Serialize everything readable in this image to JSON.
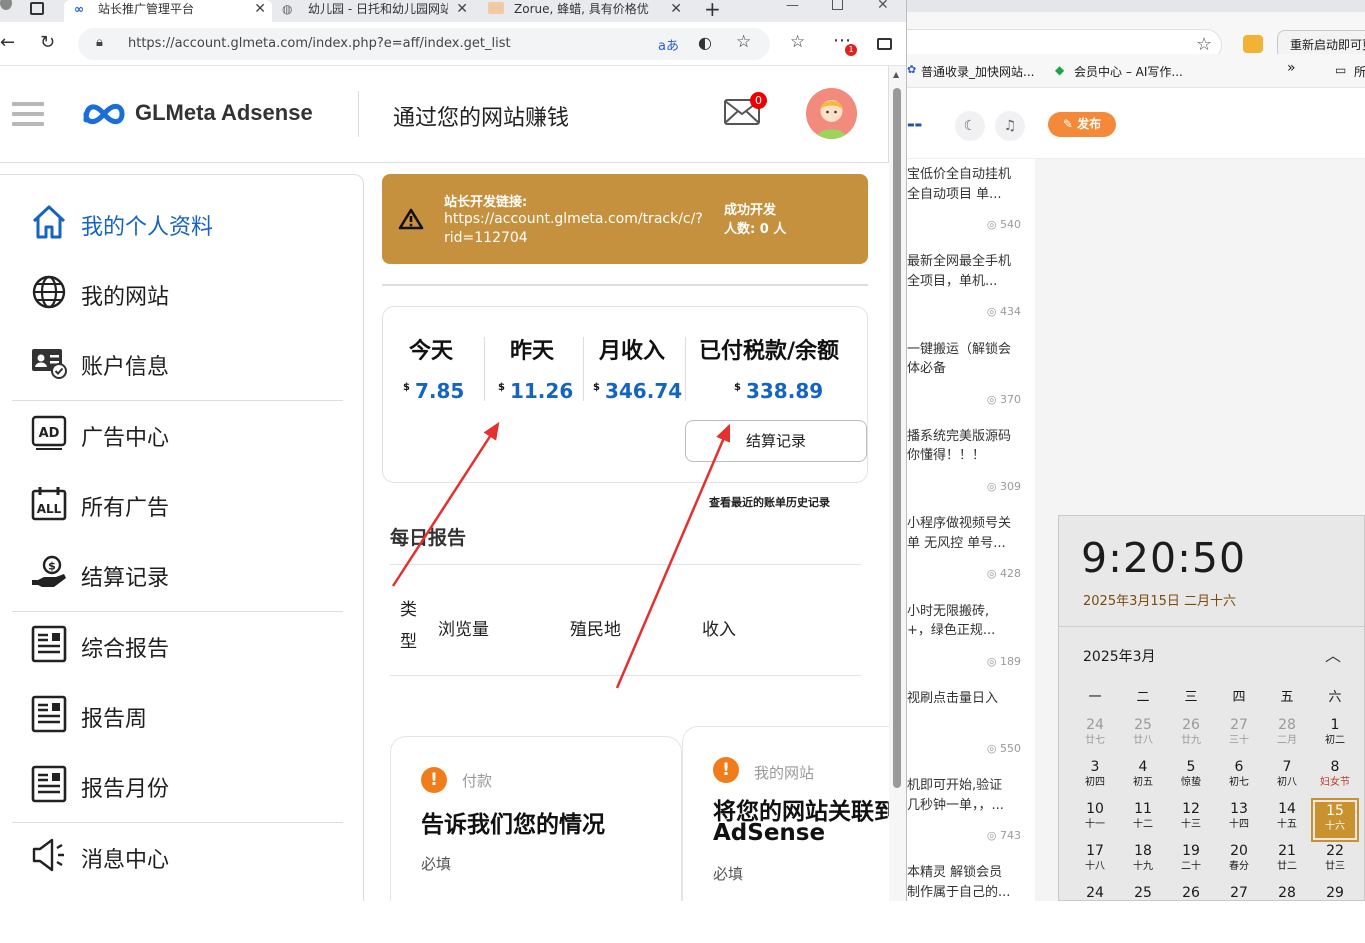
{
  "browser": {
    "tabs": [
      {
        "title": "站长推广管理平台",
        "active": true
      },
      {
        "title": "幼儿园 - 日托和幼儿园网站",
        "active": false
      },
      {
        "title": "Zorue, 蜂蜡, 具有价格优",
        "active": false
      }
    ],
    "new_tab": "+",
    "url": "https://account.glmeta.com/index.php?e=aff/index.get_list",
    "badge_count": "1"
  },
  "header": {
    "logo": "GLMeta Adsense",
    "tagline": "通过您的网站赚钱",
    "mail_count": "0"
  },
  "sidebar": {
    "items": [
      {
        "label": "我的个人资料",
        "icon": "home-icon",
        "active": true
      },
      {
        "label": "我的网站",
        "icon": "globe-icon"
      },
      {
        "label": "账户信息",
        "icon": "account-card-icon"
      },
      {
        "label": "广告中心",
        "icon": "ad-icon"
      },
      {
        "label": "所有广告",
        "icon": "all-ads-calendar-icon"
      },
      {
        "label": "结算记录",
        "icon": "payment-hand-icon"
      },
      {
        "label": "综合报告",
        "icon": "report-icon"
      },
      {
        "label": "报告周",
        "icon": "report-icon"
      },
      {
        "label": "报告月份",
        "icon": "report-icon"
      },
      {
        "label": "消息中心",
        "icon": "speaker-icon"
      }
    ]
  },
  "banner": {
    "label": "站长开发链接:",
    "link": "https://account.glmeta.com/track/c/?rid=112704",
    "success_label": "成功开发",
    "count_label": "人数:",
    "count": "0",
    "count_unit": "人",
    "accent": "#c6913e"
  },
  "stats": {
    "currency": "$",
    "today": {
      "label": "今天",
      "value": "7.85"
    },
    "yesterday": {
      "label": "昨天",
      "value": "11.26"
    },
    "month": {
      "label": "月收入",
      "value": "346.74"
    },
    "balance": {
      "label": "已付税款/余额",
      "value": "338.89"
    },
    "settle_button": "结算记录",
    "bill_link": "查看最近的账单历史记录",
    "value_color": "#1565c0"
  },
  "daily": {
    "title": "每日报告",
    "columns": [
      "类型",
      "浏览量",
      "殖民地",
      "收入"
    ]
  },
  "cards": [
    {
      "tag": "付款",
      "title": "告诉我们您的情况",
      "required": "必填"
    },
    {
      "tag": "我的网站",
      "title": "将您的网站关联到 AdSense",
      "required": "必填"
    }
  ],
  "background_window": {
    "restart_button": "重新启动即可更新",
    "bookmarks": [
      "普通收录_加快网站...",
      "会员中心 – AI写作...",
      "»",
      "所"
    ],
    "publish": "发布",
    "feed": [
      {
        "l1": "宝低价全自动挂机",
        "l2": "全自动项目 单...",
        "views": "540"
      },
      {
        "l1": "最新全网最全手机",
        "l2": "全项目，单机...",
        "views": "434"
      },
      {
        "l1": "一键搬运（解锁会",
        "l2": "体必备",
        "views": "370"
      },
      {
        "l1": "播系统完美版源码",
        "l2": "你懂得！！！",
        "views": "309"
      },
      {
        "l1": "小程序做视频号关",
        "l2": "单 无风控 单号...",
        "views": "428"
      },
      {
        "l1": "小时无限搬砖,",
        "l2": "+，绿色正规...",
        "views": "189"
      },
      {
        "l1": "视刷点击量日入",
        "l2": "",
        "views": "550"
      },
      {
        "l1": "机即可开始,验证",
        "l2": "几秒钟一单，，...",
        "views": "743"
      },
      {
        "l1": "本精灵 解锁会员",
        "l2": "制作属于自己的...",
        "views": ""
      }
    ]
  },
  "clock": {
    "time": "9:20:50",
    "date": "2025年3月15日 二月十六",
    "month": "2025年3月",
    "weekdays": [
      "一",
      "二",
      "三",
      "四",
      "五",
      "六"
    ],
    "rows": [
      [
        {
          "n": "24",
          "l": "廿七",
          "g": true
        },
        {
          "n": "25",
          "l": "廿八",
          "g": true
        },
        {
          "n": "26",
          "l": "廿九",
          "g": true
        },
        {
          "n": "27",
          "l": "三十",
          "g": true
        },
        {
          "n": "28",
          "l": "二月",
          "g": true
        },
        {
          "n": "1",
          "l": "初二"
        }
      ],
      [
        {
          "n": "3",
          "l": "初四"
        },
        {
          "n": "4",
          "l": "初五"
        },
        {
          "n": "5",
          "l": "惊蛰"
        },
        {
          "n": "6",
          "l": "初七"
        },
        {
          "n": "7",
          "l": "初八"
        },
        {
          "n": "8",
          "l": "妇女节",
          "r": true
        }
      ],
      [
        {
          "n": "10",
          "l": "十一"
        },
        {
          "n": "11",
          "l": "十二"
        },
        {
          "n": "12",
          "l": "十三"
        },
        {
          "n": "13",
          "l": "十四"
        },
        {
          "n": "14",
          "l": "十五"
        },
        {
          "n": "15",
          "l": "十六",
          "t": true
        }
      ],
      [
        {
          "n": "17",
          "l": "十八"
        },
        {
          "n": "18",
          "l": "十九"
        },
        {
          "n": "19",
          "l": "二十"
        },
        {
          "n": "20",
          "l": "春分"
        },
        {
          "n": "21",
          "l": "廿二"
        },
        {
          "n": "22",
          "l": "廿三"
        }
      ],
      [
        {
          "n": "24",
          "l": ""
        },
        {
          "n": "25",
          "l": ""
        },
        {
          "n": "26",
          "l": ""
        },
        {
          "n": "27",
          "l": ""
        },
        {
          "n": "28",
          "l": ""
        },
        {
          "n": "29",
          "l": ""
        }
      ]
    ]
  }
}
